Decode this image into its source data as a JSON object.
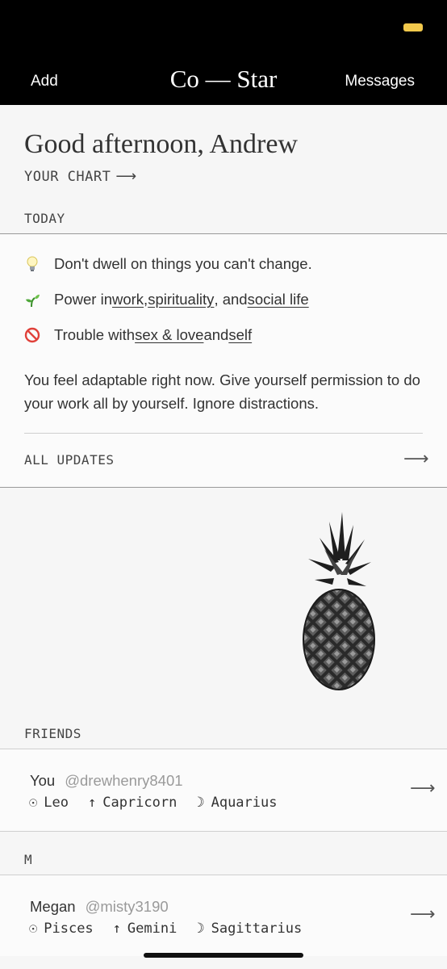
{
  "header": {
    "left_label": "Add",
    "title": "Co — Star",
    "right_label": "Messages",
    "battery_color": "#f2c94c"
  },
  "greeting": "Good afternoon, Andrew",
  "your_chart": {
    "label": "YOUR CHART",
    "arrow": "⟶"
  },
  "today": {
    "label": "TODAY",
    "tips": [
      {
        "icon": "lightbulb-icon",
        "parts": [
          "Don't dwell on things you can't change."
        ]
      },
      {
        "icon": "seedling-icon",
        "prefix": "Power in ",
        "links": [
          "work",
          "spirituality",
          "social life"
        ],
        "sep1": ", ",
        "sep2": ", and "
      },
      {
        "icon": "prohibited-icon",
        "prefix": "Trouble with ",
        "links": [
          "sex & love",
          "self"
        ],
        "sep1": " and "
      }
    ],
    "paragraph": "You feel adaptable right now. Give yourself permission to do your work all by yourself. Ignore distractions.",
    "all_updates": "ALL UPDATES",
    "arrow": "⟶"
  },
  "friends": {
    "label": "FRIENDS",
    "group_label": "M",
    "items": [
      {
        "name": "You",
        "handle": "@drewhenry8401",
        "sun_symbol": "☉",
        "sun": "Leo",
        "rising_symbol": "↑",
        "rising": "Capricorn",
        "moon_symbol": "☽",
        "moon": "Aquarius",
        "arrow": "⟶"
      },
      {
        "name": "Megan",
        "handle": "@misty3190",
        "sun_symbol": "☉",
        "sun": "Pisces",
        "rising_symbol": "↑",
        "rising": "Gemini",
        "moon_symbol": "☽",
        "moon": "Sagittarius",
        "arrow": "⟶"
      }
    ]
  }
}
